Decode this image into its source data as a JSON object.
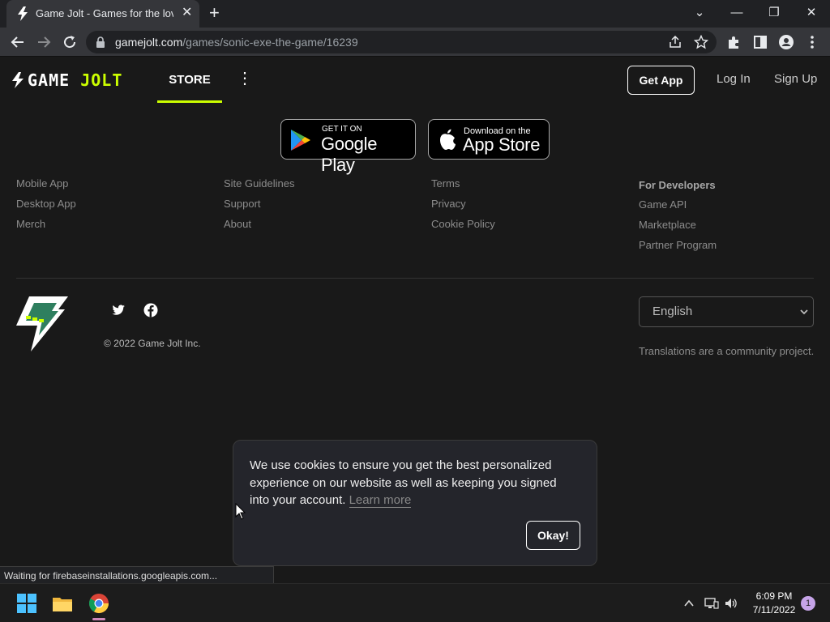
{
  "browser": {
    "tab_title": "Game Jolt - Games for the love of",
    "tab_close": "✕",
    "new_tab": "+",
    "url_domain": "gamejolt.com",
    "url_path": "/games/sonic-exe-the-game/16239",
    "window_minimize": "—",
    "window_restore": "❐",
    "window_close": "✕",
    "tab_search": "⌄"
  },
  "header": {
    "logo_text_a": "GAME ",
    "logo_text_b": "JOLT",
    "nav_store": "STORE",
    "nav_more": "⋮",
    "get_app": "Get App",
    "log_in": "Log In",
    "sign_up": "Sign Up"
  },
  "badges": {
    "google_small": "GET IT ON",
    "google_big": "Google Play",
    "apple_small": "Download on the",
    "apple_big": "App Store"
  },
  "footer": {
    "col1": [
      "Mobile App",
      "Desktop App",
      "Merch"
    ],
    "col2": [
      "Site Guidelines",
      "Support",
      "About"
    ],
    "col3": [
      "Terms",
      "Privacy",
      "Cookie Policy"
    ],
    "dev_heading": "For Developers",
    "col4": [
      "Game API",
      "Marketplace",
      "Partner Program"
    ],
    "copyright": "© 2022 Game Jolt Inc.",
    "language": "English",
    "translations_note": "Translations are a community project."
  },
  "cookie": {
    "text": "We use cookies to ensure you get the best personalized experience on our website as well as keeping you signed into your account.",
    "learn_more": "Learn more",
    "okay": "Okay!"
  },
  "status_bar": "Waiting for firebaseinstallations.googleapis.com...",
  "taskbar": {
    "time": "6:09 PM",
    "date": "7/11/2022",
    "notification_count": "1"
  },
  "colors": {
    "accent": "#ccff00",
    "background": "#191919"
  }
}
